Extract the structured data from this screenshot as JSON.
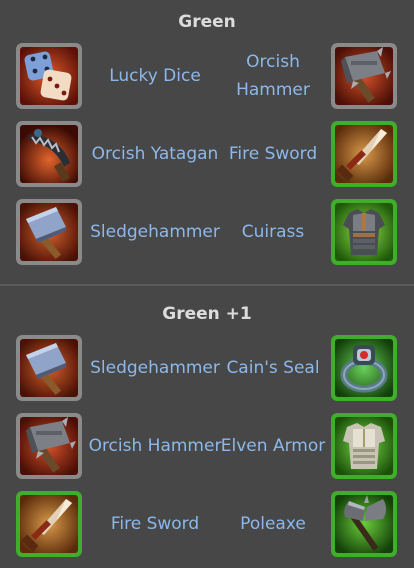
{
  "sections": [
    {
      "title": "Green",
      "rows": [
        {
          "left": {
            "name": "Lucky Dice",
            "icon": "lucky-dice-icon",
            "frame": "gray"
          },
          "right": {
            "name": "Orcish Hammer",
            "icon": "orcish-hammer-icon",
            "frame": "gray"
          }
        },
        {
          "left": {
            "name": "Orcish Yatagan",
            "icon": "orcish-yatagan-icon",
            "frame": "gray"
          },
          "right": {
            "name": "Fire Sword",
            "icon": "fire-sword-icon",
            "frame": "green"
          }
        },
        {
          "left": {
            "name": "Sledgehammer",
            "icon": "sledgehammer-icon",
            "frame": "gray"
          },
          "right": {
            "name": "Cuirass",
            "icon": "cuirass-icon",
            "frame": "green"
          }
        }
      ]
    },
    {
      "title": "Green +1",
      "rows": [
        {
          "left": {
            "name": "Sledgehammer",
            "icon": "sledgehammer-icon",
            "frame": "gray"
          },
          "right": {
            "name": "Cain's Seal",
            "icon": "cains-seal-icon",
            "frame": "green"
          }
        },
        {
          "left": {
            "name": "Orcish Hammer",
            "icon": "orcish-hammer-icon",
            "frame": "gray"
          },
          "right": {
            "name": "Elven Armor",
            "icon": "elven-armor-icon",
            "frame": "green"
          }
        },
        {
          "left": {
            "name": "Fire Sword",
            "icon": "fire-sword-icon",
            "frame": "green"
          },
          "right": {
            "name": "Poleaxe",
            "icon": "poleaxe-icon",
            "frame": "green"
          }
        }
      ]
    }
  ],
  "colors": {
    "background": "#474747",
    "heading": "#dcdcdc",
    "item_name": "#8cb8ea",
    "frame_gray": "#8a8a8a",
    "frame_green": "#3fae2a"
  }
}
